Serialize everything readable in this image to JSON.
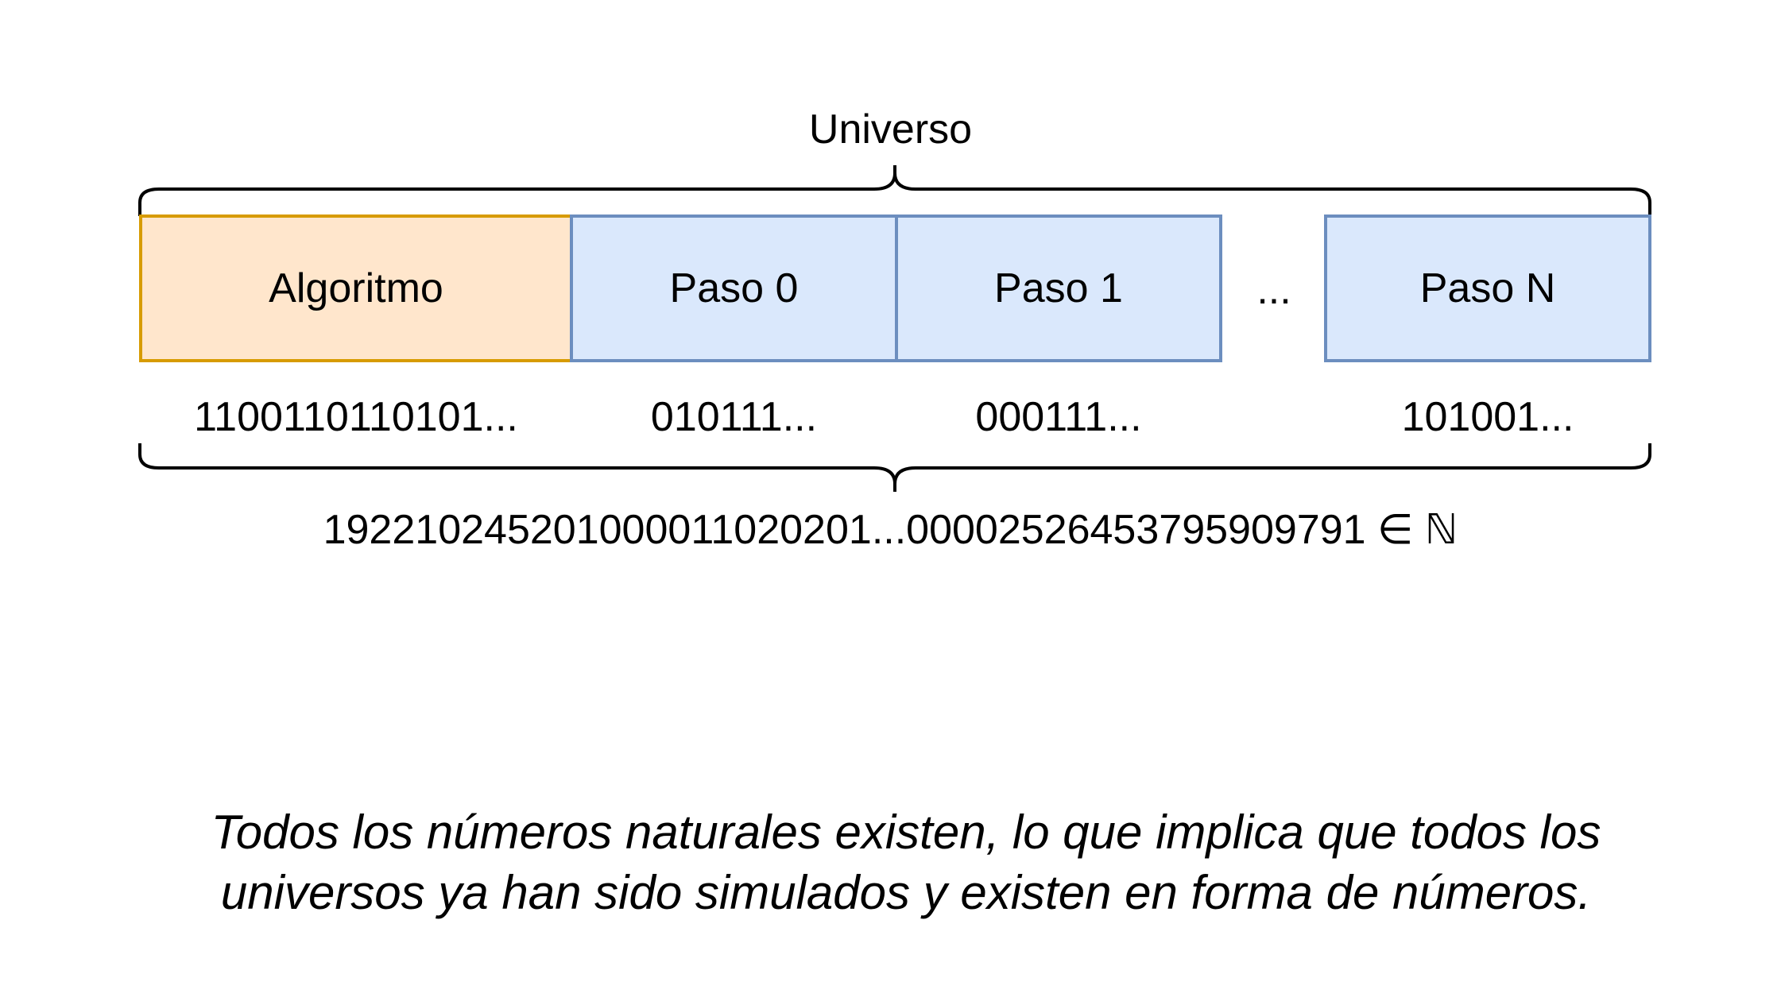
{
  "title": "Universo",
  "boxes": {
    "algorithm": "Algoritmo",
    "step0": "Paso 0",
    "step1": "Paso 1",
    "ellipsis": "...",
    "stepN": "Paso N"
  },
  "bits": {
    "algorithm": "1100110110101...",
    "step0": "010111...",
    "step1": "000111...",
    "stepN": "101001..."
  },
  "big_number": "1922102452010000110202​01...0000252645379590979​1 ∈ ℕ",
  "caption": {
    "line1": "Todos los números naturales existen, lo que implica que todos los",
    "line2": "universos ya han sido simulados y existen en forma de números."
  },
  "colors": {
    "algorithm_fill": "#ffe6cc",
    "algorithm_stroke": "#d79b00",
    "step_fill": "#dae8fc",
    "step_stroke": "#6c8ebf"
  }
}
